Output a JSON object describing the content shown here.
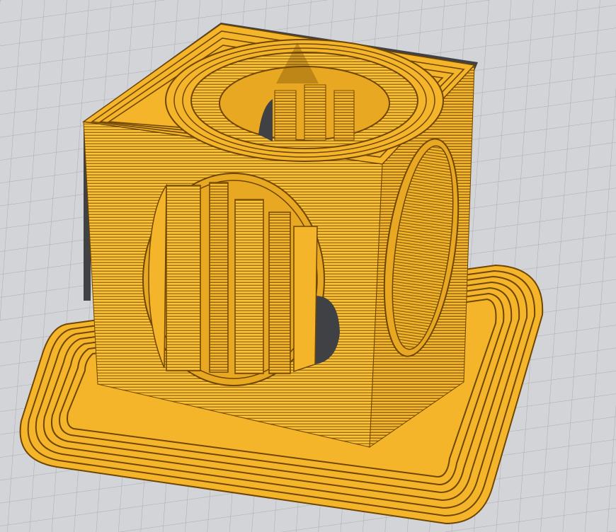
{
  "viewport": {
    "content": "3d-print-preview",
    "colors": {
      "bed_background": "#d2d4d7",
      "grid_line": "#a9abae",
      "filament": "#f4b52a",
      "filament_highlight": "#ffcf45",
      "filament_shadow": "#7a4f05",
      "model_edge_shadow": "#3f4144"
    }
  }
}
